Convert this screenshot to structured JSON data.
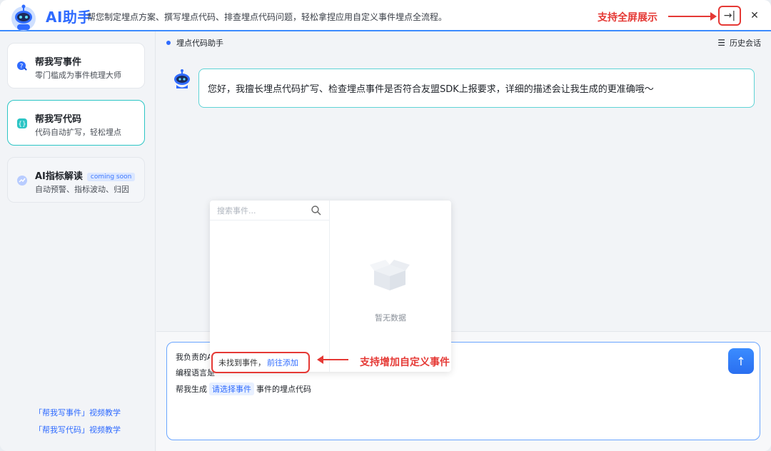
{
  "header": {
    "brand": "AI助手",
    "tagline": "帮您制定埋点方案、撰写埋点代码、排查埋点代码问题，轻松拿捏应用自定义事件埋点全流程。",
    "fullscreen_annotation": "支持全屏展示",
    "fullscreen_symbol": "→|",
    "close_symbol": "✕"
  },
  "sidebar": {
    "cards": [
      {
        "title": "帮我写事件",
        "subtitle": "零门槛成为事件梳理大师",
        "icon": "pencil-question-icon",
        "color": "#2f6bff"
      },
      {
        "title": "帮我写代码",
        "subtitle": "代码自动扩写，轻松埋点",
        "icon": "code-icon",
        "color": "#2cc5c5"
      },
      {
        "title": "AI指标解读",
        "badge": "coming soon",
        "subtitle": "自动预警、指标波动、归因",
        "icon": "chart-icon",
        "color": "#9bb8ff"
      }
    ],
    "links": [
      "「帮我写事件」视频教学",
      "「帮我写代码」视频教学"
    ]
  },
  "main": {
    "crumb": "埋点代码助手",
    "history": "历史会话",
    "history_icon": "☰",
    "greeting": "您好，我擅长埋点代码扩写、检查埋点事件是否符合友盟SDK上报要求，详细的描述会让我生成的更准确哦～",
    "composer": {
      "line1": "我负责的A",
      "line2": "编程语言是",
      "line3_prefix": "帮我生成",
      "line3_chip": "请选择事件",
      "line3_suffix": "事件的埋点代码",
      "send_symbol": "↑"
    }
  },
  "popup": {
    "search_placeholder": "搜索事件...",
    "not_found": "未找到事件，",
    "add_link": "前往添加",
    "empty_text": "暂无数据",
    "custom_annotation": "支持增加自定义事件"
  },
  "colors": {
    "accent": "#2f6bff",
    "teal": "#2cc5c5",
    "annotation_red": "#e53935"
  }
}
